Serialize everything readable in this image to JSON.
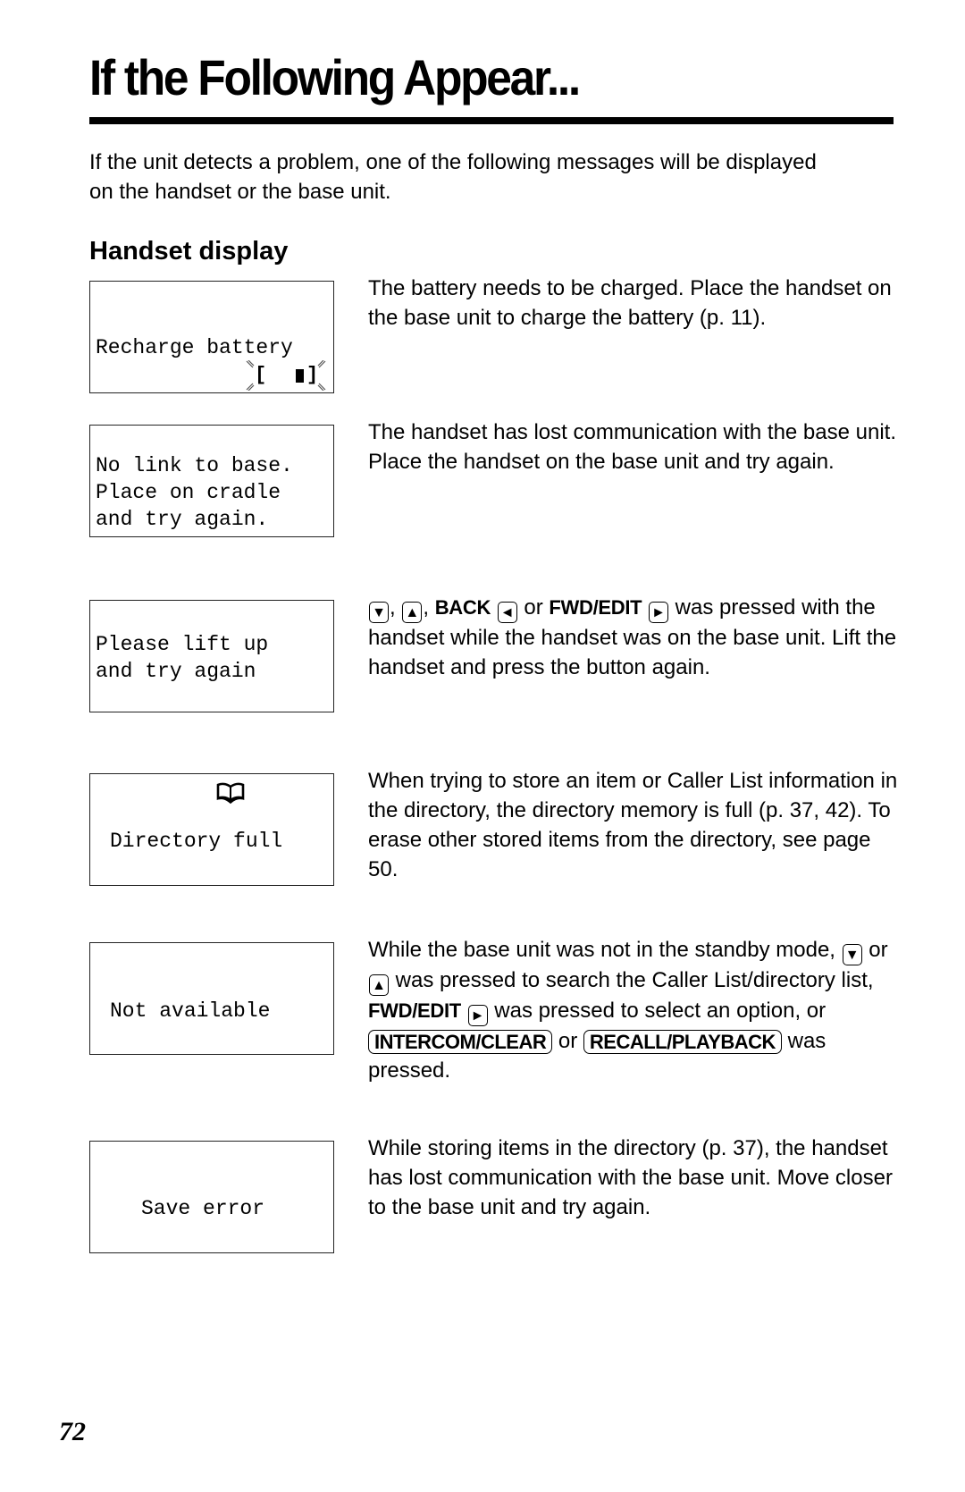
{
  "page": {
    "title": "If the Following Appear...",
    "intro": "If the unit detects a problem, one of the following messages will be displayed on the handset or the base unit.",
    "section_heading": "Handset display",
    "page_number": "72"
  },
  "entries": [
    {
      "display_lines": [
        "Recharge battery"
      ],
      "battery_indicator": {
        "left_bracket": "[",
        "right_bracket": "]",
        "icon": "battery-low-flashing-icon"
      },
      "description": "The battery needs to be charged. Place the handset on the base unit to charge the battery (p. 11)."
    },
    {
      "display_lines": [
        "No link to base.",
        "Place on cradle",
        "and try again."
      ],
      "description": "The handset has lost communication with the base unit. Place the handset on the base unit and try again."
    },
    {
      "display_lines": [
        "Please lift up",
        "and try again"
      ],
      "description_parts": {
        "key_down": "▼",
        "sep1": ", ",
        "key_up": "▲",
        "sep2": ", ",
        "back_label": "BACK",
        "key_left": "◄",
        "or1": " or ",
        "fwd_label": "FWD/EDIT",
        "key_right": "►",
        "rest": " was pressed with the handset while the handset was on the base unit. Lift the handset and press the button again."
      }
    },
    {
      "icon": "directory-book-icon",
      "display_lines": [
        "Directory full"
      ],
      "description": "When trying to store an item or Caller List information in the directory, the directory memory is full (p. 37, 42). To erase other stored items from the directory, see page 50."
    },
    {
      "display_lines": [
        "Not available"
      ],
      "description_parts": {
        "lead": "While the base unit was not in the standby mode, ",
        "key_down": "▼",
        "or1": " or ",
        "key_up": "▲",
        "mid1": " was pressed to search the Caller List/directory list, ",
        "fwd_label": "FWD/EDIT",
        "key_right": "►",
        "mid2": " was pressed to select an option, or ",
        "intercom_label": "INTERCOM/CLEAR",
        "or2": " or ",
        "recall_label": "RECALL/PLAYBACK",
        "tail": " was pressed."
      }
    },
    {
      "display_lines": [
        "Save error"
      ],
      "description": "While storing items in the directory (p. 37), the handset has lost communication with the base unit. Move closer to the base unit and try again."
    }
  ]
}
